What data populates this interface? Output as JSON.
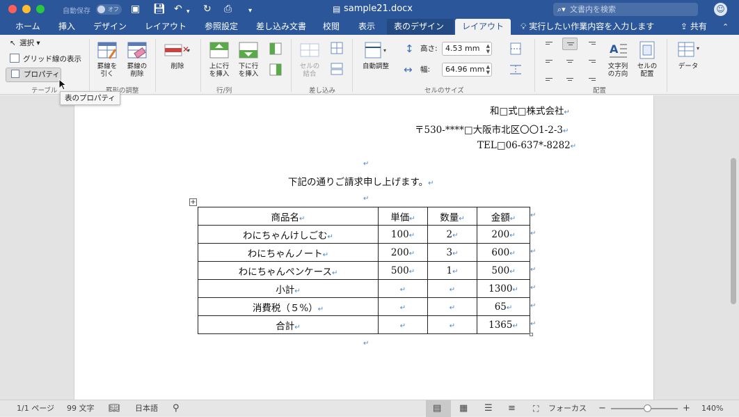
{
  "titlebar": {
    "autosave_label": "自動保存",
    "autosave_state": "オフ",
    "document_title": "sample21.docx",
    "search_placeholder": "文書内を検索",
    "colors": {
      "bar": "#2b579a"
    }
  },
  "tabs": [
    {
      "label": "ホーム"
    },
    {
      "label": "挿入"
    },
    {
      "label": "デザイン"
    },
    {
      "label": "レイアウト"
    },
    {
      "label": "参照設定"
    },
    {
      "label": "差し込み文書"
    },
    {
      "label": "校閲"
    },
    {
      "label": "表示"
    },
    {
      "label": "表のデザイン"
    },
    {
      "label": "レイアウト"
    }
  ],
  "tell_me": "実行したい作業内容を入力します",
  "share_label": "共有",
  "ribbon": {
    "table_group": {
      "select": "選択",
      "gridlines": "グリッド線の表示",
      "properties": "プロパティ",
      "label": "テーブル"
    },
    "draw_group": {
      "draw_table": "罫線を\n引く",
      "eraser": "罫線の\n削除",
      "label": "罫形の調整"
    },
    "delete_label": "削除",
    "rowscols_group": {
      "insert_above": "上に行\nを挿入",
      "insert_below": "下に行\nを挿入",
      "label": "行/列"
    },
    "merge_group": {
      "merge_cells": "セルの\n結合",
      "label": "差し込み"
    },
    "cellsize_group": {
      "autofit": "自動調整",
      "height_label": "高さ:",
      "height_value": "4.53 mm",
      "width_label": "幅:",
      "width_value": "64.96 mm",
      "label": "セルのサイズ"
    },
    "alignment_group": {
      "text_direction": "文字列\nの方向",
      "cell_margins": "セルの\n配置",
      "label": "配置"
    },
    "data_label": "データ"
  },
  "tooltip": "表のプロパティ",
  "document": {
    "company": "和□式□株式会社",
    "address": "〒530-****□大阪市北区〇〇1-2-3",
    "tel": "TEL□06-637*-8282",
    "intro": "下記の通りご請求申し上げます。",
    "para_mark": "↵",
    "table": {
      "headers": [
        "商品名",
        "単価",
        "数量",
        "金額"
      ],
      "rows": [
        [
          "わにちゃんけしごむ",
          "100",
          "2",
          "200"
        ],
        [
          "わにちゃんノート",
          "200",
          "3",
          "600"
        ],
        [
          "わにちゃんペンケース",
          "500",
          "1",
          "500"
        ],
        [
          "小計",
          "",
          "",
          "1300"
        ],
        [
          "消費税（５%）",
          "",
          "",
          "65"
        ],
        [
          "合計",
          "",
          "",
          "1365"
        ]
      ]
    }
  },
  "statusbar": {
    "pages": "1/1 ページ",
    "words": "99 文字",
    "language": "日本語",
    "focus": "フォーカス",
    "zoom": "140%",
    "zoom_percent": 140
  }
}
